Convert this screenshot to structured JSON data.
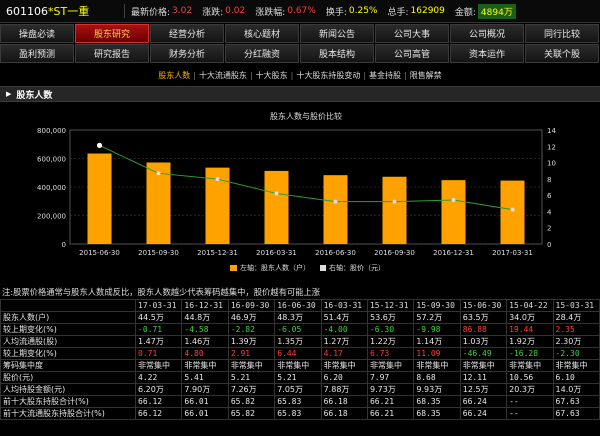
{
  "header": {
    "code": "601106",
    "name": "*ST一重",
    "price_label": "最新价格:",
    "price": "3.02",
    "change_label": "涨跌:",
    "change": "0.02",
    "pct_label": "涨跌幅:",
    "pct": "0.67%",
    "turnover_label": "换手:",
    "turnover": "0.25%",
    "volume_label": "总手:",
    "volume": "162909",
    "amount_label": "金额:",
    "amount": "4894万"
  },
  "nav": {
    "row1": [
      "操盘必读",
      "股东研究",
      "经营分析",
      "核心题材",
      "新闻公告",
      "公司大事",
      "公司概况",
      "同行比较"
    ],
    "row2": [
      "盈利预测",
      "研究报告",
      "财务分析",
      "分红融资",
      "股本结构",
      "公司高管",
      "资本运作",
      "关联个股"
    ],
    "active": "股东研究"
  },
  "subtabs": {
    "items": [
      "股东人数",
      "十大流通股东",
      "十大股东",
      "十大股东持股变动",
      "基金持股",
      "限售解禁"
    ],
    "active": "股东人数"
  },
  "section": {
    "title": "股东人数"
  },
  "chart_data": {
    "type": "bar",
    "title": "股东人数与股价比较",
    "categories": [
      "2015-06-30",
      "2015-09-30",
      "2015-12-31",
      "2016-03-31",
      "2016-06-30",
      "2016-09-30",
      "2016-12-31",
      "2017-03-31"
    ],
    "series": [
      {
        "name": "左轴：股东人数（户）",
        "kind": "bar",
        "axis": "left",
        "color": "#ffa200",
        "values": [
          635000,
          572000,
          536000,
          513000,
          483000,
          472000,
          448000,
          445000
        ]
      },
      {
        "name": "右轴：股价（元）",
        "kind": "line",
        "axis": "right",
        "color": "#2e9e2e",
        "values": [
          12.11,
          8.68,
          7.97,
          6.2,
          5.21,
          5.21,
          5.41,
          4.22
        ]
      }
    ],
    "left_axis": {
      "min": 0,
      "max": 800000,
      "ticks": [
        "0",
        "200,000",
        "400,000",
        "600,000",
        "800,000"
      ]
    },
    "right_axis": {
      "min": 0,
      "max": 14,
      "ticks": [
        "0",
        "2",
        "4",
        "6",
        "8",
        "10",
        "12",
        "14"
      ]
    },
    "grid": true,
    "legend": "bottom"
  },
  "note": "注:股票价格通常与股东人数成反比，股东人数越少代表筹码越集中，股价越有可能上涨",
  "table": {
    "headers": [
      "",
      "17-03-31",
      "16-12-31",
      "16-09-30",
      "16-06-30",
      "16-03-31",
      "15-12-31",
      "15-09-30",
      "15-06-30",
      "15-04-22",
      "15-03-31"
    ],
    "rows": [
      {
        "label": "股东人数(户)",
        "values": [
          "44.5万",
          "44.8万",
          "46.9万",
          "48.3万",
          "51.4万",
          "53.6万",
          "57.2万",
          "63.5万",
          "34.0万",
          "28.4万"
        ],
        "color": "white"
      },
      {
        "label": "较上期变化(%)",
        "values": [
          "-0.71",
          "-4.58",
          "-2.82",
          "-6.05",
          "-4.00",
          "-6.30",
          "-9.98",
          "86.88",
          "19.44",
          "2.35"
        ],
        "color": "sign"
      },
      {
        "label": "人均流通股(股)",
        "values": [
          "1.47万",
          "1.46万",
          "1.39万",
          "1.35万",
          "1.27万",
          "1.22万",
          "1.14万",
          "1.03万",
          "1.92万",
          "2.30万"
        ],
        "color": "white"
      },
      {
        "label": "较上期变化(%)",
        "values": [
          "0.71",
          "4.80",
          "2.91",
          "6.44",
          "4.17",
          "6.73",
          "11.09",
          "-46.49",
          "-16.28",
          "-2.30"
        ],
        "color": "sign"
      },
      {
        "label": "筹码集中度",
        "values": [
          "非常集中",
          "非常集中",
          "非常集中",
          "非常集中",
          "非常集中",
          "非常集中",
          "非常集中",
          "非常集中",
          "非常集中",
          "非常集中"
        ],
        "color": "cjk"
      },
      {
        "label": "股价(元)",
        "values": [
          "4.22",
          "5.41",
          "5.21",
          "5.21",
          "6.20",
          "7.97",
          "8.68",
          "12.11",
          "10.56",
          "6.10"
        ],
        "color": "white"
      },
      {
        "label": "人均持股金额(元)",
        "values": [
          "6.20万",
          "7.90万",
          "7.26万",
          "7.05万",
          "7.88万",
          "9.73万",
          "9.93万",
          "12.5万",
          "20.3万",
          "14.0万"
        ],
        "color": "white"
      },
      {
        "label": "前十大股东持股合计(%)",
        "values": [
          "66.12",
          "66.01",
          "65.82",
          "65.83",
          "66.18",
          "66.21",
          "68.35",
          "66.24",
          "--",
          "67.63"
        ],
        "color": "white"
      },
      {
        "label": "前十大流通股东持股合计(%)",
        "values": [
          "66.12",
          "66.01",
          "65.82",
          "65.83",
          "66.18",
          "66.21",
          "68.35",
          "66.24",
          "--",
          "67.63"
        ],
        "color": "white"
      }
    ]
  }
}
